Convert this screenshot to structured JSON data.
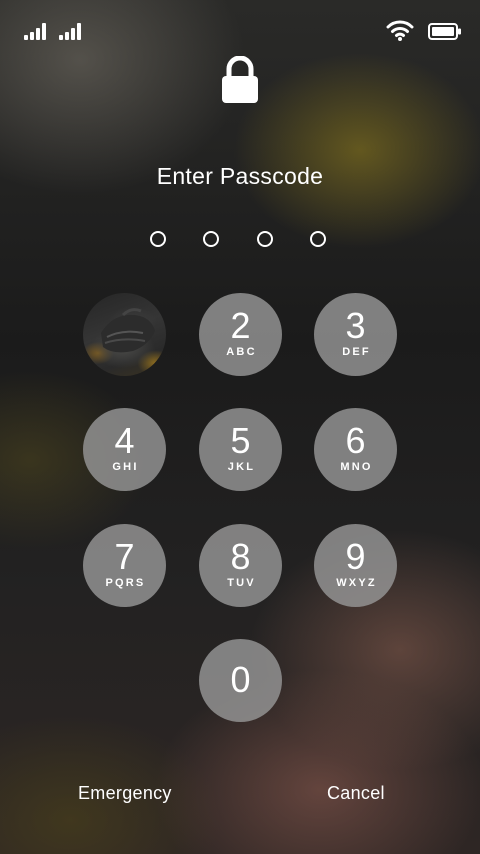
{
  "status_bar": {
    "signal_icons": [
      "cellular-signal-icon",
      "cellular-signal-icon"
    ],
    "wifi_icon": "wifi-icon",
    "battery_icon": "battery-icon"
  },
  "lock": {
    "icon": "lock-icon"
  },
  "title": "Enter Passcode",
  "passcode": {
    "length": 4,
    "entered": 0
  },
  "keypad": {
    "photo_key": {
      "icon": "photo-thumbnail"
    },
    "keys": [
      {
        "digit": "2",
        "letters": "ABC"
      },
      {
        "digit": "3",
        "letters": "DEF"
      },
      {
        "digit": "4",
        "letters": "GHI"
      },
      {
        "digit": "5",
        "letters": "JKL"
      },
      {
        "digit": "6",
        "letters": "MNO"
      },
      {
        "digit": "7",
        "letters": "PQRS"
      },
      {
        "digit": "8",
        "letters": "TUV"
      },
      {
        "digit": "9",
        "letters": "WXYZ"
      },
      {
        "digit": "0",
        "letters": ""
      }
    ]
  },
  "footer": {
    "emergency_label": "Emergency",
    "cancel_label": "Cancel"
  }
}
